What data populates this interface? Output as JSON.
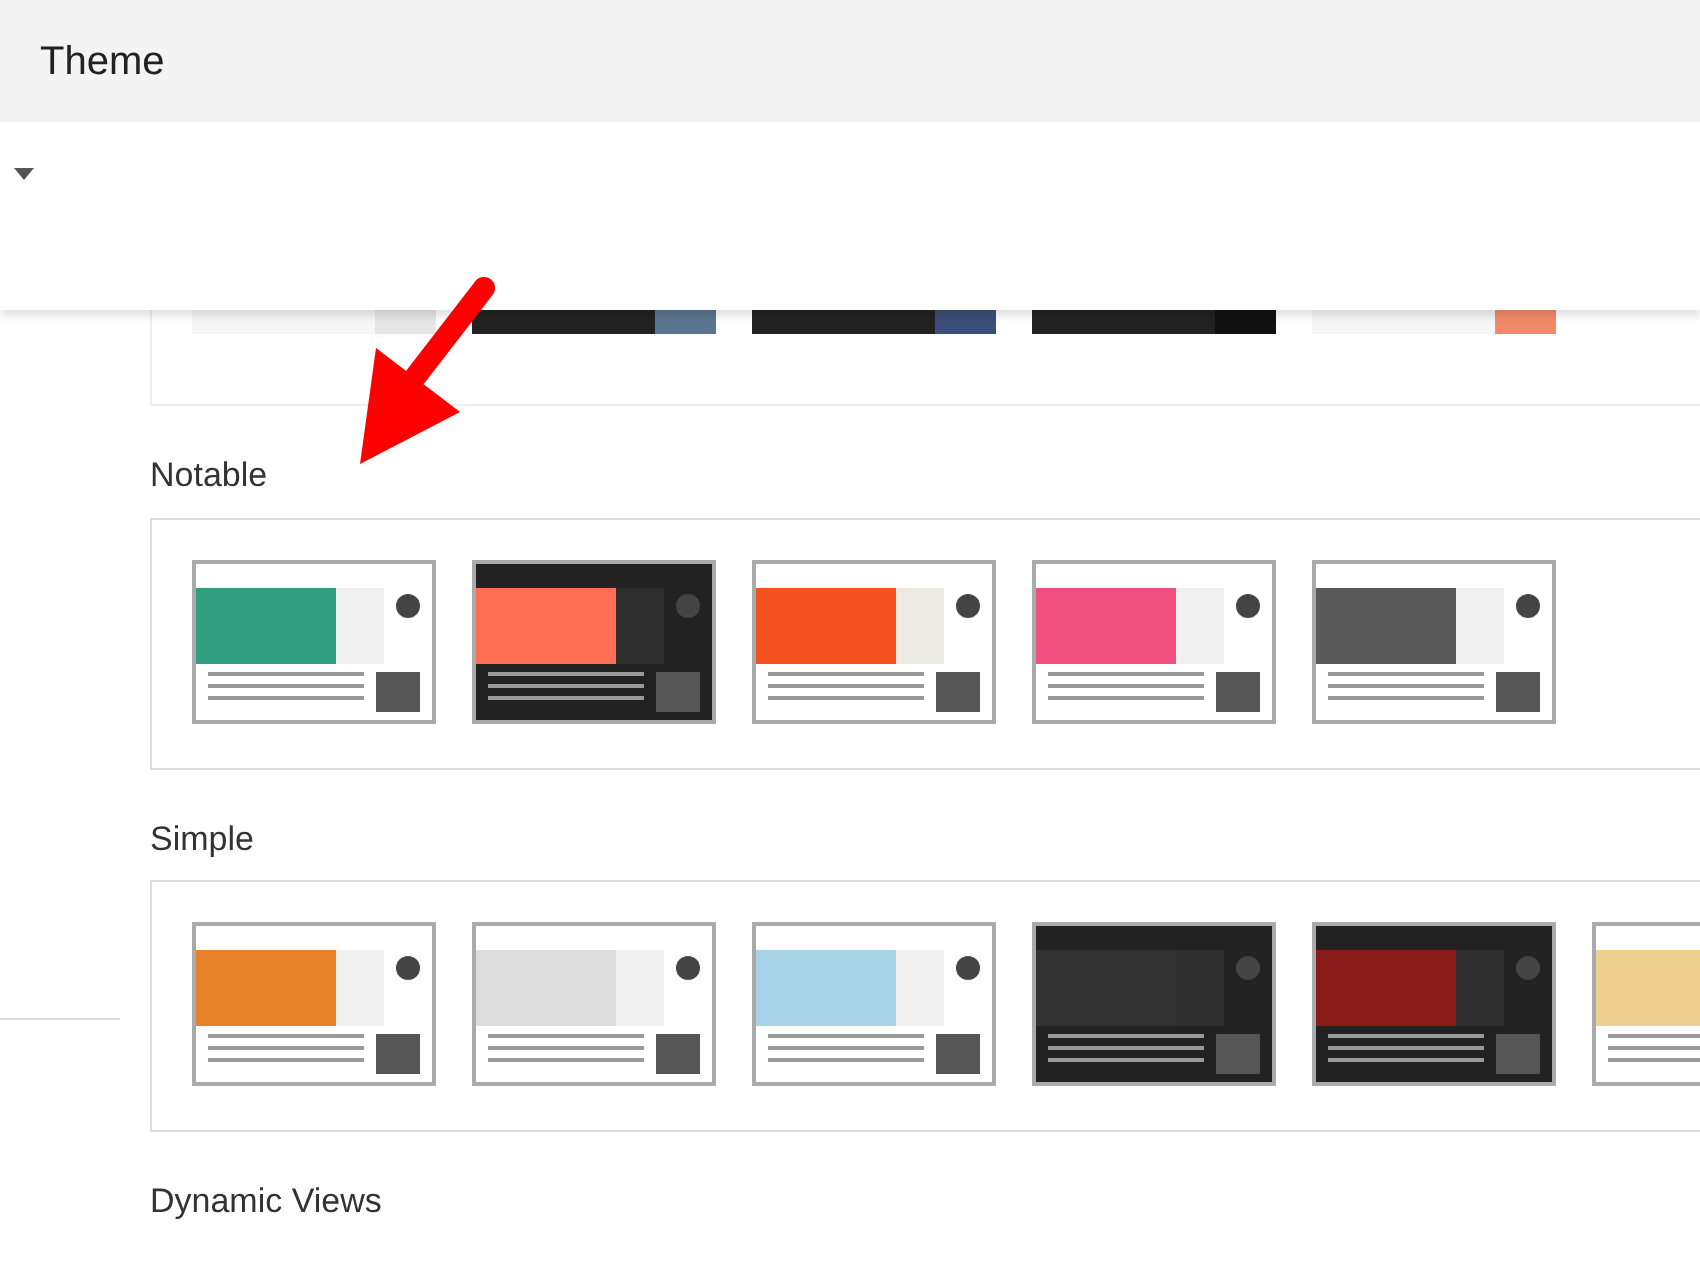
{
  "header": {
    "title": "Theme"
  },
  "sections": [
    {
      "themes": [
        {
          "kind": "light",
          "color": "#e6e6e6"
        },
        {
          "kind": "dark",
          "color": "#5b7590"
        },
        {
          "kind": "dark",
          "color": "#3c4f78"
        },
        {
          "kind": "dark",
          "color": "#111111"
        },
        {
          "kind": "light",
          "color": "#f28a6a"
        }
      ]
    },
    {
      "title": "Notable",
      "themes": [
        {
          "kind": "light",
          "color": "#2e9e7f"
        },
        {
          "kind": "dark",
          "color": "#ff6f55"
        },
        {
          "kind": "cream",
          "color": "#f4511e"
        },
        {
          "kind": "light",
          "color": "#f0507f"
        },
        {
          "kind": "light",
          "color": "#595959"
        }
      ]
    },
    {
      "title": "Simple",
      "themes": [
        {
          "kind": "light",
          "color": "#e8822a"
        },
        {
          "kind": "light",
          "color": "#dddddd"
        },
        {
          "kind": "light",
          "color": "#a9d3e8"
        },
        {
          "kind": "dark",
          "color": "#333333"
        },
        {
          "kind": "dark",
          "color": "#8b1a1a"
        },
        {
          "kind": "light",
          "color": "#f0d090"
        }
      ]
    },
    {
      "title": "Dynamic Views"
    }
  ]
}
